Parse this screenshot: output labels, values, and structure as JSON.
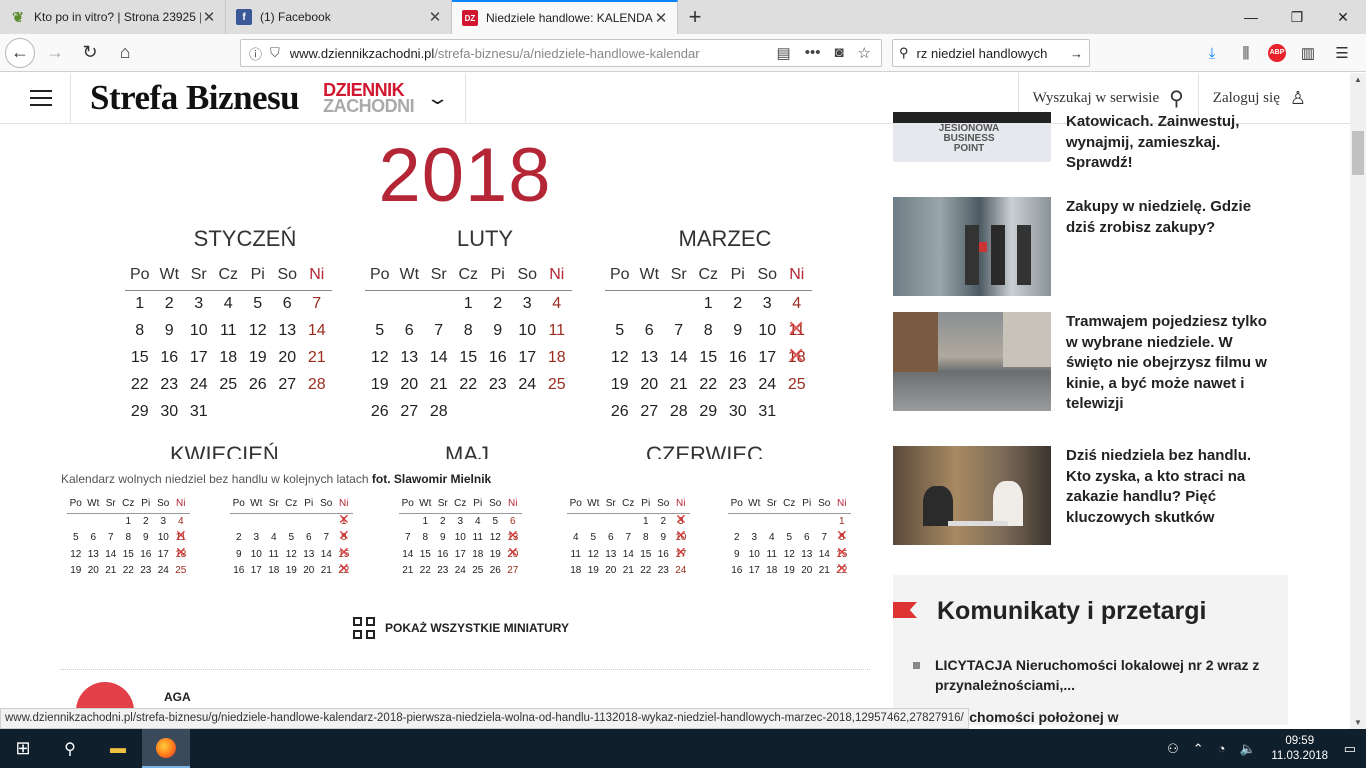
{
  "browser": {
    "tabs": [
      {
        "title": "Kto po in vitro? | Strona 23925 |",
        "icon": "plant-icon",
        "active": false
      },
      {
        "title": "(1) Facebook",
        "icon": "facebook-icon",
        "active": false
      },
      {
        "title": "Niedziele handlowe: KALENDAR",
        "icon": "dz-icon",
        "active": true
      }
    ],
    "url_domain": "www.dziennikzachodni.pl",
    "url_path": "/strefa-biznesu/a/niedziele-handlowe-kalendar",
    "search_value": "rz niedziel handlowych"
  },
  "site": {
    "logo": "Strefa Biznesu",
    "brand_line1": "DZIENNIK",
    "brand_line2": "ZACHODNI",
    "search_label": "Wyszukaj w serwisie",
    "login_label": "Zaloguj się"
  },
  "calendar": {
    "year": "2018",
    "weekdays": [
      "Po",
      "Wt",
      "Sr",
      "Cz",
      "Pi",
      "So",
      "Ni"
    ],
    "months": [
      {
        "name": "STYCZEŃ",
        "rows": [
          [
            "1",
            "2",
            "3",
            "4",
            "5",
            "6",
            "7"
          ],
          [
            "8",
            "9",
            "10",
            "11",
            "12",
            "13",
            "14"
          ],
          [
            "15",
            "16",
            "17",
            "18",
            "19",
            "20",
            "21"
          ],
          [
            "22",
            "23",
            "24",
            "25",
            "26",
            "27",
            "28"
          ],
          [
            "29",
            "30",
            "31",
            "",
            "",
            "",
            ""
          ]
        ]
      },
      {
        "name": "LUTY",
        "rows": [
          [
            "",
            "",
            "",
            "1",
            "2",
            "3",
            "4"
          ],
          [
            "5",
            "6",
            "7",
            "8",
            "9",
            "10",
            "11"
          ],
          [
            "12",
            "13",
            "14",
            "15",
            "16",
            "17",
            "18"
          ],
          [
            "19",
            "20",
            "21",
            "22",
            "23",
            "24",
            "25"
          ],
          [
            "26",
            "27",
            "28",
            "",
            "",
            "",
            ""
          ]
        ]
      },
      {
        "name": "MARZEC",
        "rows": [
          [
            "",
            "",
            "",
            "1",
            "2",
            "3",
            "4"
          ],
          [
            "5",
            "6",
            "7",
            "8",
            "9",
            "10",
            "11"
          ],
          [
            "12",
            "13",
            "14",
            "15",
            "16",
            "17",
            "18"
          ],
          [
            "19",
            "20",
            "21",
            "22",
            "23",
            "24",
            "25"
          ],
          [
            "26",
            "27",
            "28",
            "29",
            "30",
            "31",
            ""
          ]
        ]
      }
    ],
    "crossed_march": [
      "11",
      "18"
    ],
    "next_months": [
      "KWIECIEŃ",
      "MAJ",
      "CZERWIEC"
    ]
  },
  "caption": {
    "text": "Kalendarz wolnych niedziel bez handlu w kolejnych latach",
    "photo": "fot. Slawomir Mielnik"
  },
  "thumbnails": [
    {
      "rows": [
        [
          "",
          "",
          "",
          "1",
          "2",
          "3",
          "4"
        ],
        [
          "5",
          "6",
          "7",
          "8",
          "9",
          "10",
          "11"
        ],
        [
          "12",
          "13",
          "14",
          "15",
          "16",
          "17",
          "18"
        ],
        [
          "19",
          "20",
          "21",
          "22",
          "23",
          "24",
          "25"
        ]
      ],
      "crossed": [
        "11",
        "18"
      ]
    },
    {
      "rows": [
        [
          "",
          "",
          "",
          "",
          "",
          "",
          "1"
        ],
        [
          "2",
          "3",
          "4",
          "5",
          "6",
          "7",
          "8"
        ],
        [
          "9",
          "10",
          "11",
          "12",
          "13",
          "14",
          "15"
        ],
        [
          "16",
          "17",
          "18",
          "19",
          "20",
          "21",
          "22"
        ]
      ],
      "crossed": [
        "1",
        "8",
        "15",
        "22"
      ]
    },
    {
      "rows": [
        [
          "",
          "1",
          "2",
          "3",
          "4",
          "5",
          "6"
        ],
        [
          "7",
          "8",
          "9",
          "10",
          "11",
          "12",
          "13"
        ],
        [
          "14",
          "15",
          "16",
          "17",
          "18",
          "19",
          "20"
        ],
        [
          "21",
          "22",
          "23",
          "24",
          "25",
          "26",
          "27"
        ]
      ],
      "crossed": [
        "13",
        "20"
      ]
    },
    {
      "rows": [
        [
          "",
          "",
          "",
          "",
          "1",
          "2",
          "3"
        ],
        [
          "4",
          "5",
          "6",
          "7",
          "8",
          "9",
          "10"
        ],
        [
          "11",
          "12",
          "13",
          "14",
          "15",
          "16",
          "17"
        ],
        [
          "18",
          "19",
          "20",
          "21",
          "22",
          "23",
          "24"
        ]
      ],
      "crossed": [
        "3",
        "10",
        "17"
      ]
    },
    {
      "rows": [
        [
          "",
          "",
          "",
          "",
          "",
          "",
          "1"
        ],
        [
          "2",
          "3",
          "4",
          "5",
          "6",
          "7",
          "8"
        ],
        [
          "9",
          "10",
          "11",
          "12",
          "13",
          "14",
          "15"
        ],
        [
          "16",
          "17",
          "18",
          "19",
          "20",
          "21",
          "22"
        ]
      ],
      "crossed": [
        "8",
        "15",
        "22"
      ]
    }
  ],
  "show_all_label": "POKAŻ WSZYSTKIE MINIATURY",
  "comment_user": "AGA",
  "sidebar": {
    "top_partial": "Katowicach. Zainwestuj, wynajmij, zamieszkaj. Sprawdź!",
    "top_img_text": "JESIONOWA BUSINESS POINT",
    "articles": [
      "Zakupy w niedzielę. Gdzie dziś zrobisz zakupy?",
      "Tramwajem pojedziesz tylko w wybrane niedziele. W święto nie obejrzysz filmu w kinie, a być może nawet i telewizji",
      "Dziś niedziela bez handlu. Kto zyska, a kto straci na zakazie handlu? Pięć kluczowych skutków"
    ],
    "komunikaty_title": "Komunikaty i przetargi",
    "komunikaty": [
      "LICYTACJA Nieruchomości lokalowej nr 2 wraz z przynależnościami,...",
      "nieruchomości położonej w"
    ]
  },
  "status_url": "www.dziennikzachodni.pl/strefa-biznesu/g/niedziele-handlowe-kalendarz-2018-pierwsza-niedziela-wolna-od-handlu-1132018-wykaz-niedziel-handlowych-marzec-2018,12957462,27827916/",
  "taskbar": {
    "time": "09:59",
    "date": "11.03.2018"
  }
}
